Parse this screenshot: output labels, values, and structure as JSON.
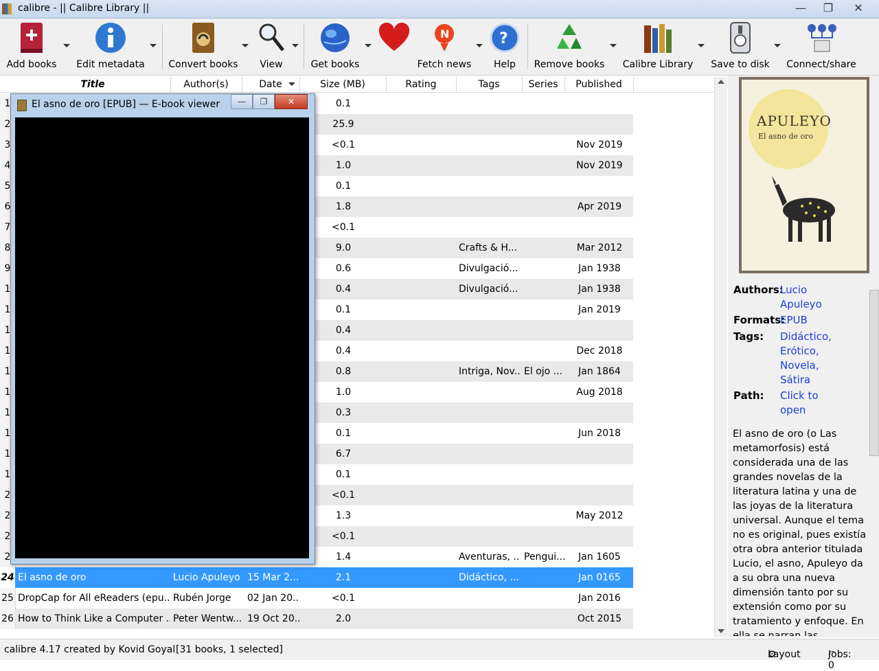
{
  "window": {
    "title": "calibre - || Calibre Library ||"
  },
  "toolbar": [
    {
      "label": "Add books",
      "icon": "add-book-icon"
    },
    {
      "label": "Edit metadata",
      "icon": "info-icon"
    },
    {
      "label": "Convert books",
      "icon": "convert-icon"
    },
    {
      "label": "View",
      "icon": "magnifier-icon"
    },
    {
      "label": "Get books",
      "icon": "globe-icon"
    },
    {
      "label": "",
      "icon": "heart-icon"
    },
    {
      "label": "Fetch news",
      "icon": "news-icon"
    },
    {
      "label": "Help",
      "icon": "help-icon"
    },
    {
      "label": "Remove books",
      "icon": "recycle-icon"
    },
    {
      "label": "Calibre Library",
      "icon": "library-icon"
    },
    {
      "label": "Save to disk",
      "icon": "disk-icon"
    },
    {
      "label": "Connect/share",
      "icon": "network-icon"
    }
  ],
  "columns": [
    "Title",
    "Author(s)",
    "Date",
    "Size (MB)",
    "Rating",
    "Tags",
    "Series",
    "Published"
  ],
  "rows": [
    {
      "num": "1",
      "title": "",
      "author": "",
      "date": "",
      "size": "0.1",
      "tags": "",
      "series": "",
      "published": ""
    },
    {
      "num": "2",
      "title": "",
      "author": "",
      "date": "",
      "size": "25.9",
      "tags": "",
      "series": "",
      "published": ""
    },
    {
      "num": "3",
      "title": "",
      "author": "",
      "date": "",
      "size": "<0.1",
      "tags": "",
      "series": "",
      "published": "Nov 2019"
    },
    {
      "num": "4",
      "title": "",
      "author": "",
      "date": "",
      "size": "1.0",
      "tags": "",
      "series": "",
      "published": "Nov 2019"
    },
    {
      "num": "5",
      "title": "",
      "author": "",
      "date": "",
      "size": "0.1",
      "tags": "",
      "series": "",
      "published": ""
    },
    {
      "num": "6",
      "title": "",
      "author": "",
      "date": "",
      "size": "1.8",
      "tags": "",
      "series": "",
      "published": "Apr 2019"
    },
    {
      "num": "7",
      "title": "",
      "author": "",
      "date": "",
      "size": "<0.1",
      "tags": "",
      "series": "",
      "published": ""
    },
    {
      "num": "8",
      "title": "",
      "author": "",
      "date": "",
      "size": "9.0",
      "tags": "Crafts & H...",
      "series": "",
      "published": "Mar 2012"
    },
    {
      "num": "9",
      "title": "",
      "author": "",
      "date": "",
      "size": "0.6",
      "tags": "Divulgació...",
      "series": "",
      "published": "Jan 1938"
    },
    {
      "num": "1",
      "title": "",
      "author": "",
      "date": "",
      "size": "0.4",
      "tags": "Divulgació...",
      "series": "",
      "published": "Jan 1938"
    },
    {
      "num": "1",
      "title": "",
      "author": "",
      "date": "",
      "size": "0.1",
      "tags": "",
      "series": "",
      "published": "Jan 2019"
    },
    {
      "num": "1",
      "title": "",
      "author": "",
      "date": "",
      "size": "0.4",
      "tags": "",
      "series": "",
      "published": ""
    },
    {
      "num": "1",
      "title": "",
      "author": "",
      "date": "",
      "size": "0.4",
      "tags": "",
      "series": "",
      "published": "Dec 2018"
    },
    {
      "num": "1",
      "title": "",
      "author": "",
      "date": "",
      "size": "0.8",
      "tags": "Intriga, Nov...",
      "series": "El ojo ...",
      "published": "Jan 1864"
    },
    {
      "num": "1",
      "title": "",
      "author": "",
      "date": "",
      "size": "1.0",
      "tags": "",
      "series": "",
      "published": "Aug 2018"
    },
    {
      "num": "1",
      "title": "",
      "author": "",
      "date": "",
      "size": "0.3",
      "tags": "",
      "series": "",
      "published": ""
    },
    {
      "num": "1",
      "title": "",
      "author": "",
      "date": "",
      "size": "0.1",
      "tags": "",
      "series": "",
      "published": "Jun 2018"
    },
    {
      "num": "1",
      "title": "",
      "author": "",
      "date": "",
      "size": "6.7",
      "tags": "",
      "series": "",
      "published": ""
    },
    {
      "num": "1",
      "title": "",
      "author": "",
      "date": "",
      "size": "0.1",
      "tags": "",
      "series": "",
      "published": ""
    },
    {
      "num": "2",
      "title": "",
      "author": "",
      "date": "",
      "size": "<0.1",
      "tags": "",
      "series": "",
      "published": ""
    },
    {
      "num": "2",
      "title": "",
      "author": "",
      "date": "",
      "size": "1.3",
      "tags": "",
      "series": "",
      "published": "May 2012"
    },
    {
      "num": "2",
      "title": "",
      "author": "",
      "date": "",
      "size": "<0.1",
      "tags": "",
      "series": "",
      "published": ""
    },
    {
      "num": "2",
      "title": "",
      "author": "",
      "date": "",
      "size": "1.4",
      "tags": "Aventuras, ...",
      "series": "Pengui...",
      "published": "Jan 1605"
    },
    {
      "num": "24",
      "title": "El asno de oro",
      "author": "Lucio Apuleyo",
      "date": "15 Mar 2...",
      "size": "2.1",
      "tags": "Didáctico, ...",
      "series": "",
      "published": "Jan 0165",
      "selected": true
    },
    {
      "num": "25",
      "title": "DropCap for All eReaders (epu...",
      "author": "Rubén Jorge",
      "date": "02 Jan 20...",
      "size": "<0.1",
      "tags": "",
      "series": "",
      "published": "Jan 2016"
    },
    {
      "num": "26",
      "title": "How to Think Like a Computer ...",
      "author": "Peter Wentw...",
      "date": "19 Oct 20...",
      "size": "2.0",
      "tags": "",
      "series": "",
      "published": "Oct 2015"
    }
  ],
  "viewer": {
    "title": "El asno de oro [EPUB] — E-book viewer"
  },
  "cover": {
    "author": "APULEYO",
    "title": "El asno de oro"
  },
  "details": {
    "authors_label": "Authors:",
    "authors": [
      "Lucio",
      "Apuleyo"
    ],
    "formats_label": "Formats:",
    "formats": "EPUB",
    "tags_label": "Tags:",
    "tags": [
      "Didáctico,",
      "Erótico,",
      "Novela,",
      "Sátira"
    ],
    "path_label": "Path:",
    "path": [
      "Click to",
      "open"
    ],
    "description": "El asno de oro (o Las metamorfosis) está considerada una de las grandes novelas de la literatura latina y una de las joyas de la literatura universal. Aunque el tema no es original, pues existía otra obra anterior titulada Lucio, el asno, Apuleyo da a su obra una nueva dimensión tanto por su extensión como por su tratamiento y enfoque. En ella se narran las aventuras"
  },
  "status": {
    "left": "calibre 4.17 created by Kovid Goyal",
    "count": "[31 books, 1 selected]",
    "layout": "Layout",
    "jobs": "Jobs: 0"
  },
  "colors": {
    "selection": "#3399ff",
    "link": "#1c3fd6",
    "viewer_frame": "#b9d1ea"
  }
}
